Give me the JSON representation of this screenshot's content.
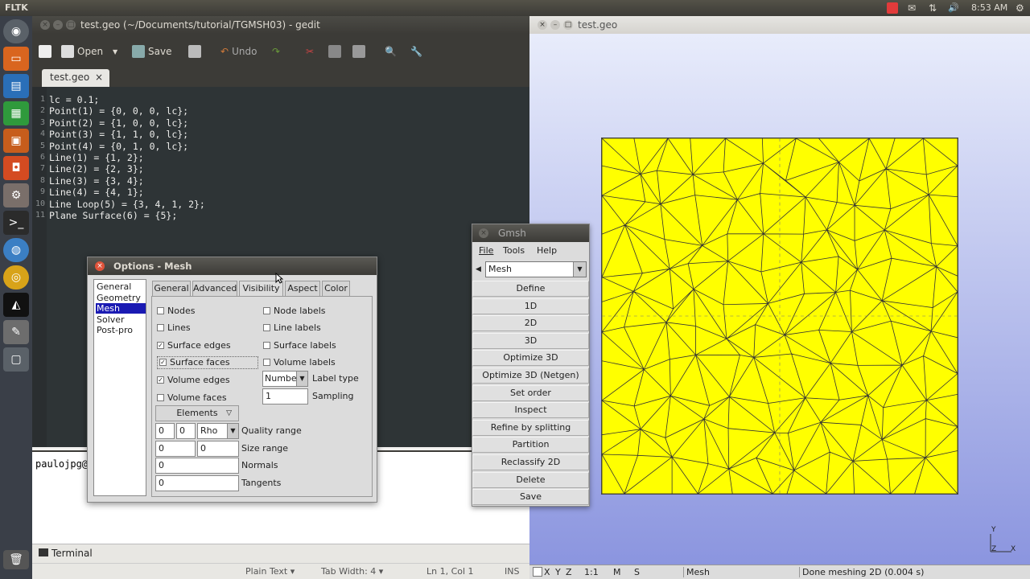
{
  "top_panel": {
    "app_name": "FLTK",
    "clock": "8:53 AM"
  },
  "gedit": {
    "title": "test.geo (~/Documents/tutorial/TGMSH03) - gedit",
    "toolbar": {
      "open": "Open",
      "save": "Save",
      "undo": "Undo"
    },
    "tab": "test.geo",
    "lines": [
      {
        "n": "1",
        "text": "lc = 0.1;"
      },
      {
        "n": "2",
        "text": "Point(1) = {0, 0, 0, lc};"
      },
      {
        "n": "3",
        "text": "Point(2) = {1, 0, 0, lc};"
      },
      {
        "n": "4",
        "text": "Point(3) = {1, 1, 0, lc};"
      },
      {
        "n": "5",
        "text": "Point(4) = {0, 1, 0, lc};"
      },
      {
        "n": "6",
        "text": "Line(1) = {1, 2};"
      },
      {
        "n": "7",
        "text": "Line(2) = {2, 3};"
      },
      {
        "n": "8",
        "text": "Line(3) = {3, 4};"
      },
      {
        "n": "9",
        "text": "Line(4) = {4, 1};"
      },
      {
        "n": "10",
        "text": "Line Loop(5) = {3, 4, 1, 2};"
      },
      {
        "n": "11",
        "text": "Plane Surface(6) = {5};"
      }
    ],
    "terminal_prompt": "paulojpg@",
    "terminal_tab": "Terminal",
    "status": {
      "language": "Plain Text",
      "tab_width": "Tab Width: 4",
      "position": "Ln 1, Col 1",
      "mode": "INS"
    }
  },
  "gmsh_view": {
    "title": "test.geo",
    "axes": {
      "y": "Y",
      "z": "Z",
      "x": "X"
    },
    "status_module": "Mesh",
    "status_message": "Done meshing 2D (0.004 s)",
    "status_buttons": [
      "X",
      "Y",
      "Z",
      "1:1",
      "M",
      "S"
    ]
  },
  "gmsh_menu": {
    "title": "Gmsh",
    "menus": [
      "File",
      "Tools",
      "Help"
    ],
    "module": "Mesh",
    "buttons": [
      "Define",
      "1D",
      "2D",
      "3D",
      "Optimize 3D",
      "Optimize 3D (Netgen)",
      "Set order",
      "Inspect",
      "Refine by splitting",
      "Partition",
      "Reclassify 2D",
      "Delete",
      "Save"
    ]
  },
  "options": {
    "title": "Options - Mesh",
    "categories": [
      "General",
      "Geometry",
      "Mesh",
      "Solver",
      "Post-pro"
    ],
    "selected_category": "Mesh",
    "tabs": [
      "General",
      "Advanced",
      "Visibility",
      "Aspect",
      "Color"
    ],
    "active_tab": "Visibility",
    "left_checks": [
      {
        "label": "Nodes",
        "checked": false
      },
      {
        "label": "Lines",
        "checked": false
      },
      {
        "label": "Surface edges",
        "checked": true
      },
      {
        "label": "Surface faces",
        "checked": true
      },
      {
        "label": "Volume edges",
        "checked": true
      },
      {
        "label": "Volume faces",
        "checked": false
      }
    ],
    "right_checks": [
      {
        "label": "Node labels",
        "checked": false
      },
      {
        "label": "Line labels",
        "checked": false
      },
      {
        "label": "Surface labels",
        "checked": false
      },
      {
        "label": "Volume labels",
        "checked": false
      }
    ],
    "label_type_value": "Numbe",
    "label_type_label": "Label type",
    "sampling_value": "1",
    "sampling_label": "Sampling",
    "elements_button": "Elements",
    "quality_min": "0",
    "quality_max": "0",
    "quality_type": "Rho",
    "quality_label": "Quality range",
    "size_min": "0",
    "size_max": "0",
    "size_label": "Size range",
    "normals_value": "0",
    "normals_label": "Normals",
    "tangents_value": "0",
    "tangents_label": "Tangents"
  }
}
